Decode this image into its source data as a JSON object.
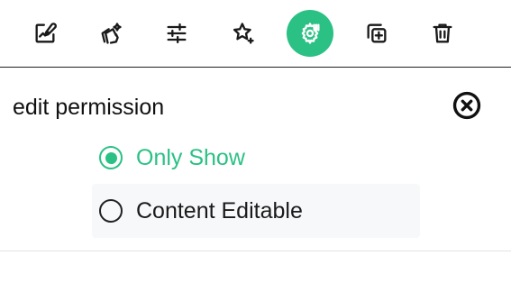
{
  "colors": {
    "accent": "#2bc185",
    "icon": "#1a1a1a",
    "active_icon": "#ffffff",
    "divider": "#e3e3e3",
    "option_hover_bg": "#f6f8fa"
  },
  "toolbar": {
    "tools": [
      {
        "icon": "edit-image-icon"
      },
      {
        "icon": "magic-layers-icon"
      },
      {
        "icon": "sliders-icon"
      },
      {
        "icon": "star-sparkle-icon"
      },
      {
        "icon": "gear-settings-icon",
        "active": true
      },
      {
        "icon": "duplicate-icon"
      },
      {
        "icon": "trash-icon"
      }
    ]
  },
  "panel": {
    "title": "edit permission",
    "close_icon": "close-circle-icon",
    "options": [
      {
        "label": "Only Show",
        "selected": true
      },
      {
        "label": "Content Editable",
        "selected": false
      }
    ]
  }
}
